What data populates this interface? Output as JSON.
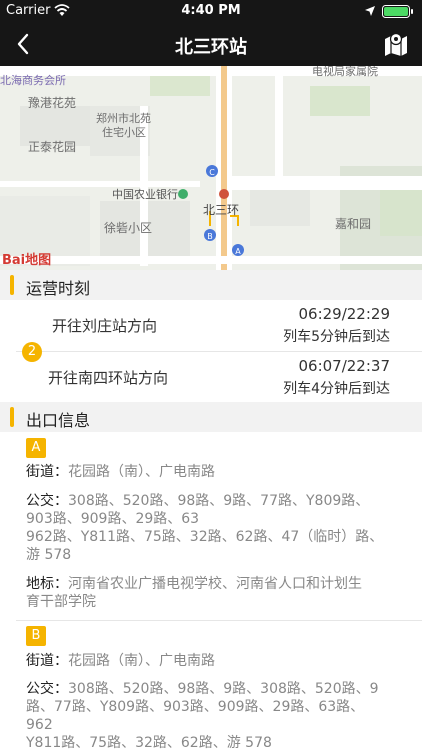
{
  "status": {
    "carrier": "Carrier",
    "time": "4:40 PM"
  },
  "nav": {
    "title": "北三环站"
  },
  "map": {
    "labels": {
      "business_hall": "北海商务会所",
      "yugang": "豫港花苑",
      "zhengtai": "正泰花园",
      "zhengzhou": "郑州市北苑",
      "zhuzhai": "住宅小区",
      "tv_bureau": "电视局家属院",
      "bank": "中国农业银行",
      "station": "北三环",
      "xubi": "徐砦小区",
      "jiahe": "嘉和园",
      "logo": "Bai地图"
    },
    "exit_markers": [
      "C",
      "B",
      "A"
    ]
  },
  "schedule": {
    "title": "运营时刻",
    "line_number": "2",
    "rows": [
      {
        "direction": "开往刘庄站方向",
        "hours": "06:29/22:29",
        "next": "列车5分钟后到达"
      },
      {
        "direction": "开往南四环站方向",
        "hours": "06:07/22:37",
        "next": "列车4分钟后到达"
      }
    ]
  },
  "exits": {
    "title": "出口信息",
    "items": [
      {
        "letter": "A",
        "street_key": "街道：",
        "street": "花园路（南）、广电南路",
        "bus_key": "公交：",
        "bus_line1": "308路、520路、98路、9路、77路、Y809路、",
        "bus_line2": "903路、909路、29路、63",
        "bus_line3": "962路、Y811路、75路、32路、62路、47（临时）路、",
        "bus_line4": "游 578",
        "landmark_key": "地标：",
        "landmark_line1": "河南省农业广播电视学校、河南省人口和计划生",
        "landmark_line2": "育干部学院"
      },
      {
        "letter": "B",
        "street_key": "街道：",
        "street": "花园路（南）、广电南路",
        "bus_key": "公交：",
        "bus_line1": "308路、520路、98路、9路、308路、520路、9",
        "bus_line2": "路、77路、Y809路、903路、909路、29路、63路、",
        "bus_line3": "962",
        "bus_line4": "Y811路、75路、32路、62路、游 578"
      }
    ]
  }
}
